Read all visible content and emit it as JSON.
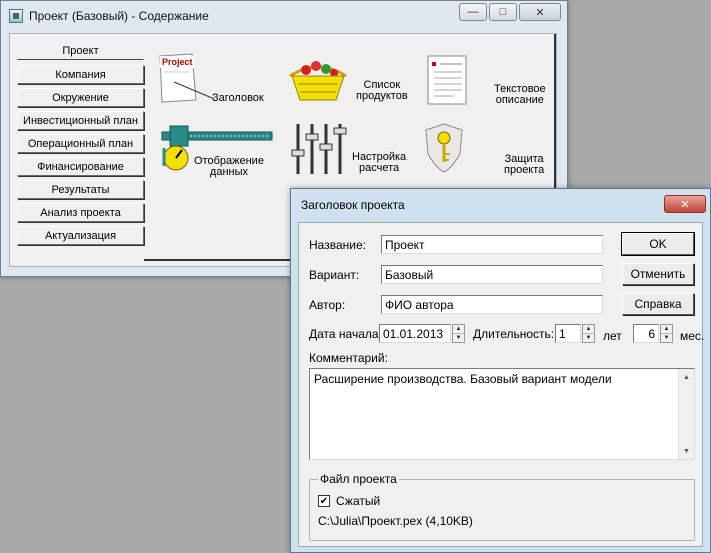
{
  "main_window": {
    "title": "Проект (Базовый) - Содержание",
    "nav": [
      "Проект",
      "Компания",
      "Окружение",
      "Инвестиционный план",
      "Операционный план",
      "Финансирование",
      "Результаты",
      "Анализ проекта",
      "Актуализация"
    ],
    "features": {
      "header": {
        "label": "Заголовок",
        "badge": "Project",
        "icon": "project-document-icon"
      },
      "products": {
        "label": "Список\nпродуктов",
        "icon": "basket-icon"
      },
      "text": {
        "label": "Текстовое\nописание",
        "icon": "text-document-icon"
      },
      "display": {
        "label": "Отображение\nданных",
        "icon": "caliper-icon"
      },
      "settings": {
        "label": "Настройка\nрасчета",
        "icon": "sliders-icon"
      },
      "protect": {
        "label": "Защита\nпроекта",
        "icon": "shield-key-icon"
      }
    }
  },
  "dialog": {
    "title": "Заголовок проекта",
    "fields": {
      "name_label": "Название:",
      "name_value": "Проект",
      "variant_label": "Вариант:",
      "variant_value": "Базовый",
      "author_label": "Автор:",
      "author_value": "ФИО автора",
      "start_label": "Дата начала:",
      "start_value": "01.01.2013",
      "duration_label": "Длительность:",
      "duration_years": "1",
      "years_unit": "лет",
      "duration_months": "6",
      "months_unit": "мес.",
      "comment_label": "Комментарий:",
      "comment_value": "Расширение производства. Базовый вариант модели"
    },
    "buttons": {
      "ok": "OK",
      "cancel": "Отменить",
      "help": "Справка"
    },
    "file_group": {
      "title": "Файл проекта",
      "compressed_label": "Сжатый",
      "compressed_checked": true,
      "path": "C:\\Julia\\Проект.pex (4,10KB)"
    }
  }
}
